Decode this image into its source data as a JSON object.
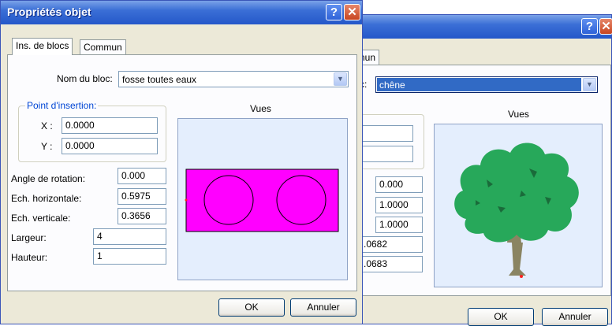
{
  "back_dialog": {
    "tab_partial": "nun",
    "name_label_partial": "c:",
    "name_value": "chêne",
    "views_label": "Vues",
    "fields": [
      "0.000",
      "1.0000",
      "1.0000",
      ".0682",
      ".0683"
    ],
    "ok_label": "OK",
    "cancel_label": "Annuler",
    "help_glyph": "?",
    "close_glyph": "✕"
  },
  "front_dialog": {
    "title": "Propriétés objet",
    "help_glyph": "?",
    "close_glyph": "✕",
    "tabs": [
      "Ins. de blocs",
      "Commun"
    ],
    "block_name_label": "Nom du bloc:",
    "block_name_value": "fosse toutes eaux",
    "insertion_group_label": "Point d'insertion:",
    "x_label": "X :",
    "x_value": "0.0000",
    "y_label": "Y :",
    "y_value": "0.0000",
    "rotation_label": "Angle de rotation:",
    "rotation_value": "0.000",
    "hscale_label": "Ech. horizontale:",
    "hscale_value": "0.5975",
    "vscale_label": "Ech. verticale:",
    "vscale_value": "0.3656",
    "width_label": "Largeur:",
    "width_value": "4",
    "height_label": "Hauteur:",
    "height_value": "1",
    "views_label": "Vues",
    "ok_label": "OK",
    "cancel_label": "Annuler"
  },
  "colors": {
    "block_fill": "#ff00ff",
    "preview_bg": "#e4eefd",
    "tree_green": "#27a85a",
    "trunk": "#8a8462"
  }
}
